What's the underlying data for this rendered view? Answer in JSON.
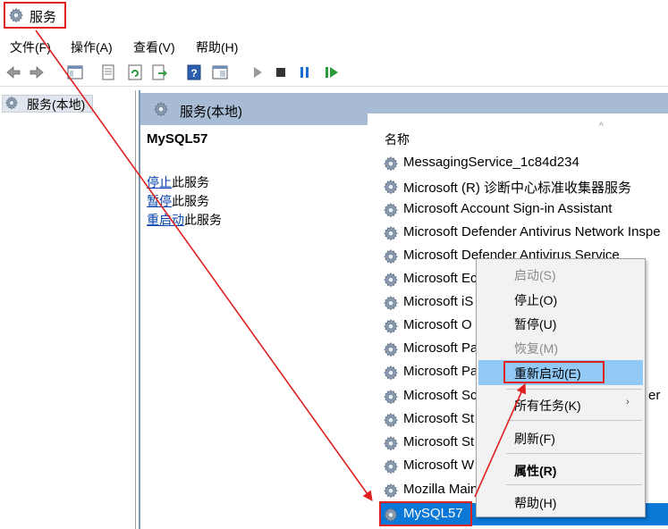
{
  "window": {
    "title": "服务"
  },
  "menu": {
    "items": [
      "文件(F)",
      "操作(A)",
      "查看(V)",
      "帮助(H)"
    ]
  },
  "toolbar": {
    "icons": [
      "back-icon",
      "forward-icon",
      "show-tree-icon",
      "properties-icon",
      "refresh-icon",
      "export-icon",
      "help-icon",
      "view-icon",
      "start-icon",
      "stop-icon",
      "pause-icon",
      "restart-icon"
    ]
  },
  "tree": {
    "label": "服务(本地)"
  },
  "pane": {
    "header": "服务(本地)",
    "service_name": "MySQL57",
    "links": [
      {
        "link": "停止",
        "rest": "此服务"
      },
      {
        "link": "暂停",
        "rest": "此服务"
      },
      {
        "link": "重启动",
        "rest": "此服务"
      }
    ],
    "column_name": "名称",
    "rows": [
      "MessagingService_1c84d234",
      "Microsoft (R) 诊断中心标准收集器服务",
      "Microsoft Account Sign-in Assistant",
      "Microsoft Defender Antivirus Network Inspe",
      "Microsoft Defender Antivirus Service",
      "Microsoft Ec",
      "Microsoft iS",
      "Microsoft O",
      "Microsoft Pa",
      "Microsoft Pa",
      "Microsoft Sc",
      "Microsoft St",
      "Microsoft St",
      "Microsoft W",
      "Mozilla Main",
      "MySQL57"
    ],
    "row_tail": "er"
  },
  "context_menu": {
    "items": [
      {
        "label": "启动(S)",
        "disabled": true
      },
      {
        "label": "停止(O)",
        "disabled": false
      },
      {
        "label": "暂停(U)",
        "disabled": false
      },
      {
        "label": "恢复(M)",
        "disabled": true
      },
      {
        "label": "重新启动(E)",
        "disabled": false,
        "highlighted": true
      },
      {
        "label": "所有任务(K)",
        "disabled": false,
        "submenu": true
      },
      {
        "label": "刷新(F)",
        "disabled": false
      },
      {
        "label": "属性(R)",
        "disabled": false,
        "bold": true
      },
      {
        "label": "帮助(H)",
        "disabled": false
      }
    ],
    "submenu_arrow": "›"
  },
  "colors": {
    "selection": "#0a78d7",
    "menu_highlight": "#91c9f7",
    "annotation": "#e02020",
    "pane_header": "#a7bbd4"
  }
}
